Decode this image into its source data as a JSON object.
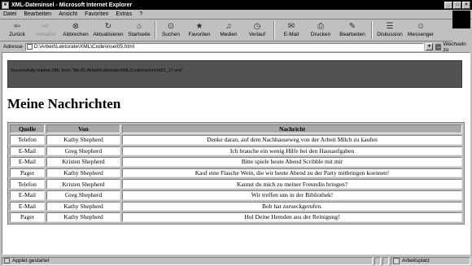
{
  "window": {
    "title": "XML-Dateninsel - Microsoft Internet Explorer",
    "controls": [
      "_",
      "□",
      "×"
    ]
  },
  "menu": [
    "Datei",
    "Bearbeiten",
    "Ansicht",
    "Favoriten",
    "Extras",
    "?"
  ],
  "toolbar": [
    {
      "label": "Zurück",
      "icon": "back-arrow-icon",
      "glyph": "⇦"
    },
    {
      "label": "Vorwärts",
      "icon": "forward-arrow-icon",
      "glyph": "⇨",
      "disabled": true
    },
    {
      "label": "Abbrechen",
      "icon": "stop-icon",
      "glyph": "⊗"
    },
    {
      "label": "Aktualisieren",
      "icon": "refresh-icon",
      "glyph": "↻"
    },
    {
      "label": "Startseite",
      "icon": "home-icon",
      "glyph": "⌂"
    },
    {
      "label": "Suchen",
      "icon": "search-icon",
      "glyph": "⊙"
    },
    {
      "label": "Favoriten",
      "icon": "favorites-icon",
      "glyph": "★"
    },
    {
      "label": "Medien",
      "icon": "media-icon",
      "glyph": "♫"
    },
    {
      "label": "Verlauf",
      "icon": "history-icon",
      "glyph": "◷"
    },
    {
      "label": "E-Mail",
      "icon": "mail-icon",
      "glyph": "✉"
    },
    {
      "label": "Drucken",
      "icon": "print-icon",
      "glyph": "⎙"
    },
    {
      "label": "Bearbeiten",
      "icon": "edit-icon",
      "glyph": "✎"
    },
    {
      "label": "Diskussion",
      "icon": "discussion-icon",
      "glyph": "☰"
    },
    {
      "label": "Messenger",
      "icon": "messenger-icon",
      "glyph": "☺"
    }
  ],
  "address": {
    "label": "Adresse",
    "value": "D:\\Arbeit\\Lektorate\\XML\\Code\\insel05.html",
    "go_label": "Wechseln zu"
  },
  "applet": {
    "message": "Successfully loaded XML from \"file:/D:/Arbeit/Lektorate/XML/Code/nachricht01_17.xml\""
  },
  "page": {
    "heading": "Meine Nachrichten"
  },
  "table": {
    "headers": [
      "Quelle",
      "Von",
      "Nachricht"
    ],
    "rows": [
      [
        "Telefon",
        "Kathy Shepherd",
        "Denke daran, auf dem Nachhauseweg von der Arbeit Milch zu kaufen"
      ],
      [
        "E-Mail",
        "Greg Shepherd",
        "Ich brauche ein wenig Hilfe bei den Hausaufgaben"
      ],
      [
        "E-Mail",
        "Kristen Shepherd",
        "Bitte spiele heute Abend Scribble mit mir"
      ],
      [
        "Pager",
        "Kathy Shepherd",
        "Kauf eine Flasche Wein, die wir heute Abend zu der Party mitbringen koennen!"
      ],
      [
        "Telefon",
        "Kristen Shepherd",
        "Kannst du mich zu meiner Freundin bringen?"
      ],
      [
        "E-Mail",
        "Greg Shepherd",
        "Wir treffen uns in der Bibliothek!"
      ],
      [
        "E-Mail",
        "Kathy Shepherd",
        "Bob hat zurueckgerufen."
      ],
      [
        "Pager",
        "Kathy Shepherd",
        "Hol Deine Hemden aus der Reinigung!"
      ]
    ]
  },
  "status": {
    "text": "Applet gestartet",
    "zone": "Arbeitsplatz"
  }
}
